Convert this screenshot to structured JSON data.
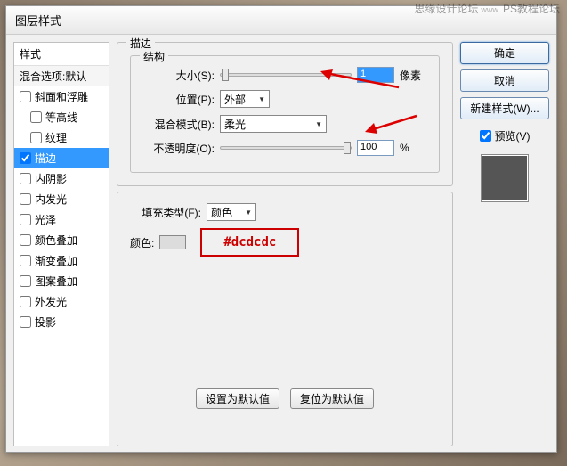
{
  "watermark": {
    "line1": "思缘设计论坛",
    "line2": "www.",
    "line3": "PS教程论坛"
  },
  "dialog_title": "图层样式",
  "left": {
    "header": "样式",
    "blend": "混合选项:默认",
    "items": [
      {
        "label": "斜面和浮雕",
        "checked": false,
        "indent": false
      },
      {
        "label": "等高线",
        "checked": false,
        "indent": true
      },
      {
        "label": "纹理",
        "checked": false,
        "indent": true
      },
      {
        "label": "描边",
        "checked": true,
        "indent": false,
        "selected": true
      },
      {
        "label": "内阴影",
        "checked": false,
        "indent": false
      },
      {
        "label": "内发光",
        "checked": false,
        "indent": false
      },
      {
        "label": "光泽",
        "checked": false,
        "indent": false
      },
      {
        "label": "颜色叠加",
        "checked": false,
        "indent": false
      },
      {
        "label": "渐变叠加",
        "checked": false,
        "indent": false
      },
      {
        "label": "图案叠加",
        "checked": false,
        "indent": false
      },
      {
        "label": "外发光",
        "checked": false,
        "indent": false
      },
      {
        "label": "投影",
        "checked": false,
        "indent": false
      }
    ]
  },
  "center": {
    "title": "描边",
    "structure": "结构",
    "size_label": "大小(S):",
    "size_value": "1",
    "size_unit": "像素",
    "position_label": "位置(P):",
    "position_value": "外部",
    "blend_label": "混合模式(B):",
    "blend_value": "柔光",
    "opacity_label": "不透明度(O):",
    "opacity_value": "100",
    "opacity_unit": "%",
    "fill_label": "填充类型(F):",
    "fill_value": "颜色",
    "color_label": "颜色:",
    "color_hex": "#dcdcdc",
    "make_default": "设置为默认值",
    "reset_default": "复位为默认值"
  },
  "right": {
    "ok": "确定",
    "cancel": "取消",
    "new_style": "新建样式(W)...",
    "preview": "预览(V)"
  }
}
